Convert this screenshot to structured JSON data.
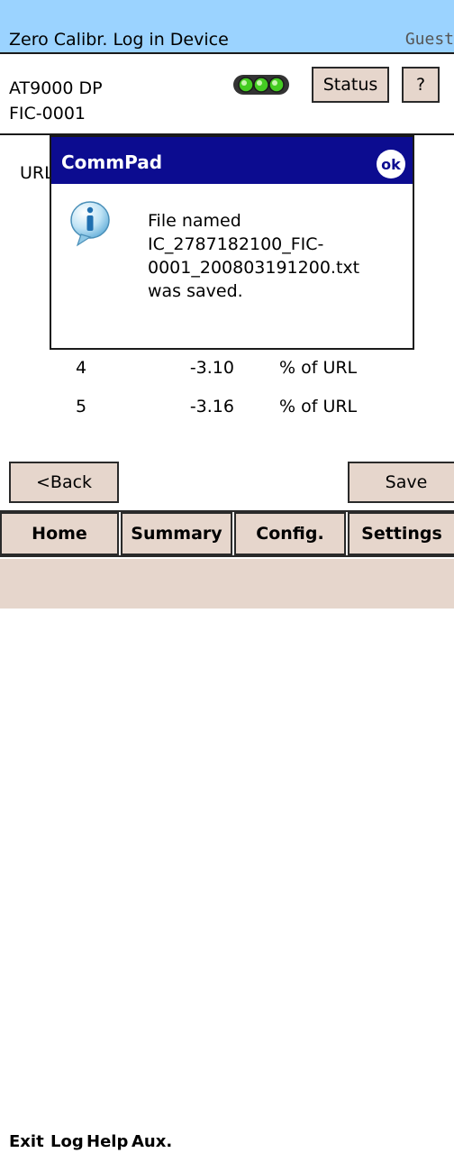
{
  "window": {
    "title": "Zero Calibr. Log in Device",
    "user": "Guest"
  },
  "device": {
    "model": "AT9000 DP",
    "tag": "FIC-0001"
  },
  "header_buttons": {
    "status_label": "Status",
    "help_label": "?"
  },
  "content": {
    "url_label": "URL",
    "rows": [
      {
        "index": "4",
        "value": "-3.10",
        "unit": "% of URL"
      },
      {
        "index": "5",
        "value": "-3.16",
        "unit": "% of URL"
      }
    ]
  },
  "actions": {
    "back_label": "<Back",
    "save_label": "Save"
  },
  "tabs": [
    {
      "label": "Home"
    },
    {
      "label": "Summary"
    },
    {
      "label": "Config."
    },
    {
      "label": "Settings"
    }
  ],
  "menu": [
    {
      "label": "Exit"
    },
    {
      "label": "Log"
    },
    {
      "label": "Help"
    },
    {
      "label": "Aux."
    }
  ],
  "dialog": {
    "title": "CommPad",
    "ok_label": "ok",
    "message_lines": [
      "File named",
      "IC_2787182100_FIC-",
      "0001_200803191200.txt",
      "was saved."
    ]
  },
  "colors": {
    "title_bar": "#9bd3ff",
    "button_face": "#e6d6cc",
    "dialog_title_bar": "#0c0c90",
    "status_light": "#44cc22"
  }
}
